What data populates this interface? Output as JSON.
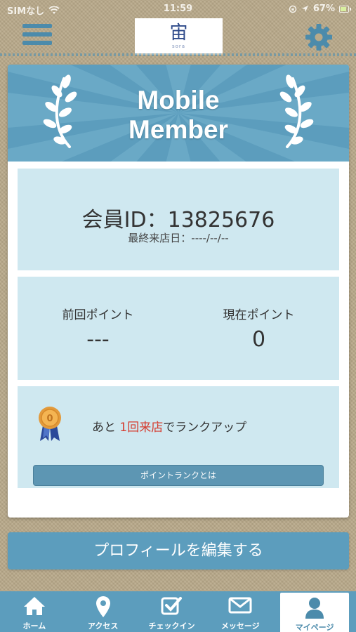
{
  "status_bar": {
    "carrier": "SIMなし",
    "time": "11:59",
    "battery": "67%"
  },
  "header": {
    "logo_text": "sora",
    "menu_icon": "hamburger-menu-icon",
    "settings_icon": "gear-icon"
  },
  "banner": {
    "title_line1": "Mobile",
    "title_line2": "Member"
  },
  "member": {
    "id_label": "会員ID：13825676",
    "last_visit": "最終来店日：----/--/--"
  },
  "points": {
    "previous_label": "前回ポイント",
    "previous_value": "---",
    "current_label": "現在ポイント",
    "current_value": "0"
  },
  "rank": {
    "prefix": "あと ",
    "highlight": "1回来店",
    "suffix": "でランクアップ",
    "button": "ポイントランクとは"
  },
  "profile_button": "プロフィールを編集する",
  "tabs": [
    {
      "label": "ホーム",
      "icon": "home-icon"
    },
    {
      "label": "アクセス",
      "icon": "map-pin-icon"
    },
    {
      "label": "チェックイン",
      "icon": "checkin-icon"
    },
    {
      "label": "メッセージ",
      "icon": "mail-icon"
    },
    {
      "label": "マイページ",
      "icon": "user-icon"
    }
  ],
  "colors": {
    "accent": "#5c9dbd",
    "panel": "#cfe8f0",
    "highlight": "#d53b2e"
  }
}
